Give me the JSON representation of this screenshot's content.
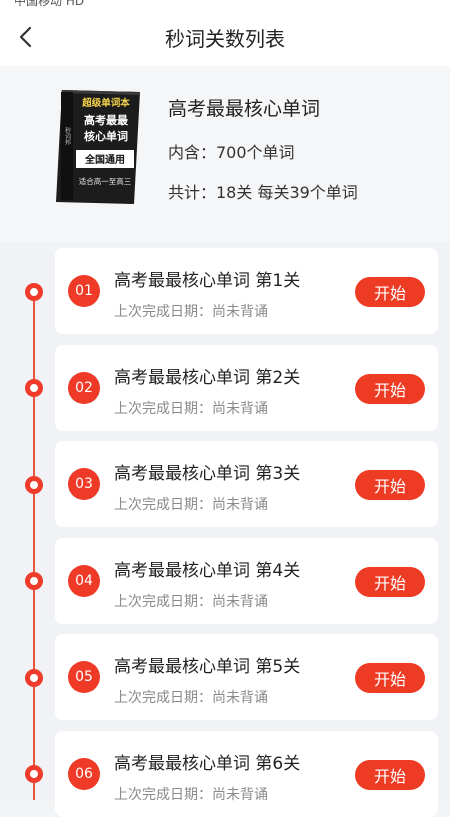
{
  "status_bar": {
    "carrier": "中国移动 HD"
  },
  "nav": {
    "title": "秒词关数列表"
  },
  "book": {
    "cover": {
      "top": "超级单词本",
      "title_line1": "高考最最",
      "title_line2": "核心单词",
      "band": "全国通用",
      "subtitle": "适合高一至高三",
      "side": "秒词邦"
    },
    "title": "高考最最核心单词",
    "word_count": "内含：700个单词",
    "summary": "共计：18关 每关39个单词"
  },
  "levels": [
    {
      "num": "01",
      "title": "高考最最核心单词 第1关",
      "sub": "上次完成日期：尚未背诵",
      "button": "开始"
    },
    {
      "num": "02",
      "title": "高考最最核心单词 第2关",
      "sub": "上次完成日期：尚未背诵",
      "button": "开始"
    },
    {
      "num": "03",
      "title": "高考最最核心单词 第3关",
      "sub": "上次完成日期：尚未背诵",
      "button": "开始"
    },
    {
      "num": "04",
      "title": "高考最最核心单词 第4关",
      "sub": "上次完成日期：尚未背诵",
      "button": "开始"
    },
    {
      "num": "05",
      "title": "高考最最核心单词 第5关",
      "sub": "上次完成日期：尚未背诵",
      "button": "开始"
    },
    {
      "num": "06",
      "title": "高考最最核心单词 第6关",
      "sub": "上次完成日期：尚未背诵",
      "button": "开始"
    }
  ],
  "colors": {
    "accent": "#ee3b24",
    "timeline": "#e8553f"
  }
}
